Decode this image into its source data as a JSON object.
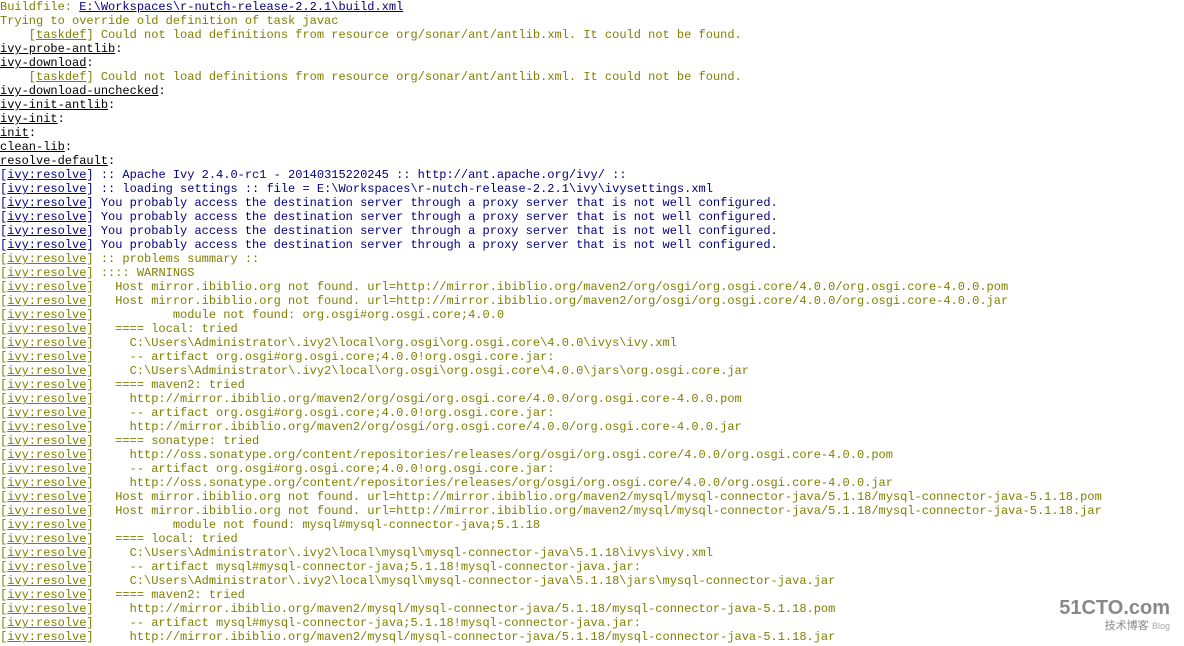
{
  "buildfile_label": "Buildfile: ",
  "buildfile_path": "E:\\Workspaces\\r-nutch-release-2.2.1\\build.xml",
  "override_msg": "Trying to override old definition of task javac",
  "taskdef_open": "    [",
  "taskdef_tag": "taskdef",
  "taskdef_msg": "] Could not load definitions from resource org/sonar/ant/antlib.xml. It could not be found.",
  "tgt_ivy_probe_antlib": "ivy-probe-antlib",
  "tgt_ivy_download": "ivy-download",
  "tgt_ivy_download_unchecked": "ivy-download-unchecked",
  "tgt_ivy_init_antlib": "ivy-init-antlib",
  "tgt_ivy_init": "ivy-init",
  "tgt_init": "init",
  "tgt_clean_lib": "clean-lib",
  "tgt_resolve_default": "resolve-default",
  "colon": ":",
  "br_open": "[",
  "br_close": "] ",
  "ivy_resolve_tag": "ivy:resolve",
  "msg_ivy_version": ":: Apache Ivy 2.4.0-rc1 - 20140315220245 :: http://ant.apache.org/ivy/ ::",
  "msg_loading": ":: loading settings :: file = E:\\Workspaces\\r-nutch-release-2.2.1\\ivy\\ivysettings.xml",
  "msg_proxy": "You probably access the destination server through a proxy server that is not well configured.",
  "msg_problems": ":: problems summary ::",
  "msg_warnings": ":::: WARNINGS",
  "msg_host_osgi_pom": "\tHost mirror.ibiblio.org not found. url=http://mirror.ibiblio.org/maven2/org/osgi/org.osgi.core/4.0.0/org.osgi.core-4.0.0.pom",
  "msg_host_osgi_jar": "\tHost mirror.ibiblio.org not found. url=http://mirror.ibiblio.org/maven2/org/osgi/org.osgi.core/4.0.0/org.osgi.core-4.0.0.jar",
  "msg_mod_osgi": "\t\tmodule not found: org.osgi#org.osgi.core;4.0.0",
  "msg_local_tried": "\t==== local: tried",
  "msg_osgi_local_ivy": "\t  C:\\Users\\Administrator\\.ivy2\\local\\org.osgi\\org.osgi.core\\4.0.0\\ivys\\ivy.xml",
  "msg_osgi_artifact": "\t  -- artifact org.osgi#org.osgi.core;4.0.0!org.osgi.core.jar:",
  "msg_osgi_local_jar": "\t  C:\\Users\\Administrator\\.ivy2\\local\\org.osgi\\org.osgi.core\\4.0.0\\jars\\org.osgi.core.jar",
  "msg_maven2_tried": "\t==== maven2: tried",
  "msg_osgi_m2_pom": "\t  http://mirror.ibiblio.org/maven2/org/osgi/org.osgi.core/4.0.0/org.osgi.core-4.0.0.pom",
  "msg_osgi_m2_jar": "\t  http://mirror.ibiblio.org/maven2/org/osgi/org.osgi.core/4.0.0/org.osgi.core-4.0.0.jar",
  "msg_sonatype_tried": "\t==== sonatype: tried",
  "msg_osgi_st_pom": "\t  http://oss.sonatype.org/content/repositories/releases/org/osgi/org.osgi.core/4.0.0/org.osgi.core-4.0.0.pom",
  "msg_osgi_st_jar": "\t  http://oss.sonatype.org/content/repositories/releases/org/osgi/org.osgi.core/4.0.0/org.osgi.core-4.0.0.jar",
  "msg_host_mysql_pom": "\tHost mirror.ibiblio.org not found. url=http://mirror.ibiblio.org/maven2/mysql/mysql-connector-java/5.1.18/mysql-connector-java-5.1.18.pom",
  "msg_host_mysql_jar": "\tHost mirror.ibiblio.org not found. url=http://mirror.ibiblio.org/maven2/mysql/mysql-connector-java/5.1.18/mysql-connector-java-5.1.18.jar",
  "msg_mod_mysql": "\t\tmodule not found: mysql#mysql-connector-java;5.1.18",
  "msg_mysql_local_ivy": "\t  C:\\Users\\Administrator\\.ivy2\\local\\mysql\\mysql-connector-java\\5.1.18\\ivys\\ivy.xml",
  "msg_mysql_artifact": "\t  -- artifact mysql#mysql-connector-java;5.1.18!mysql-connector-java.jar:",
  "msg_mysql_local_jar": "\t  C:\\Users\\Administrator\\.ivy2\\local\\mysql\\mysql-connector-java\\5.1.18\\jars\\mysql-connector-java.jar",
  "msg_mysql_m2_pom": "\t  http://mirror.ibiblio.org/maven2/mysql/mysql-connector-java/5.1.18/mysql-connector-java-5.1.18.pom",
  "msg_mysql_m2_jar": "\t  http://mirror.ibiblio.org/maven2/mysql/mysql-connector-java/5.1.18/mysql-connector-java-5.1.18.jar",
  "watermark_big": "51CTO.com",
  "watermark_small": "技术博客",
  "watermark_blog": "Blog"
}
